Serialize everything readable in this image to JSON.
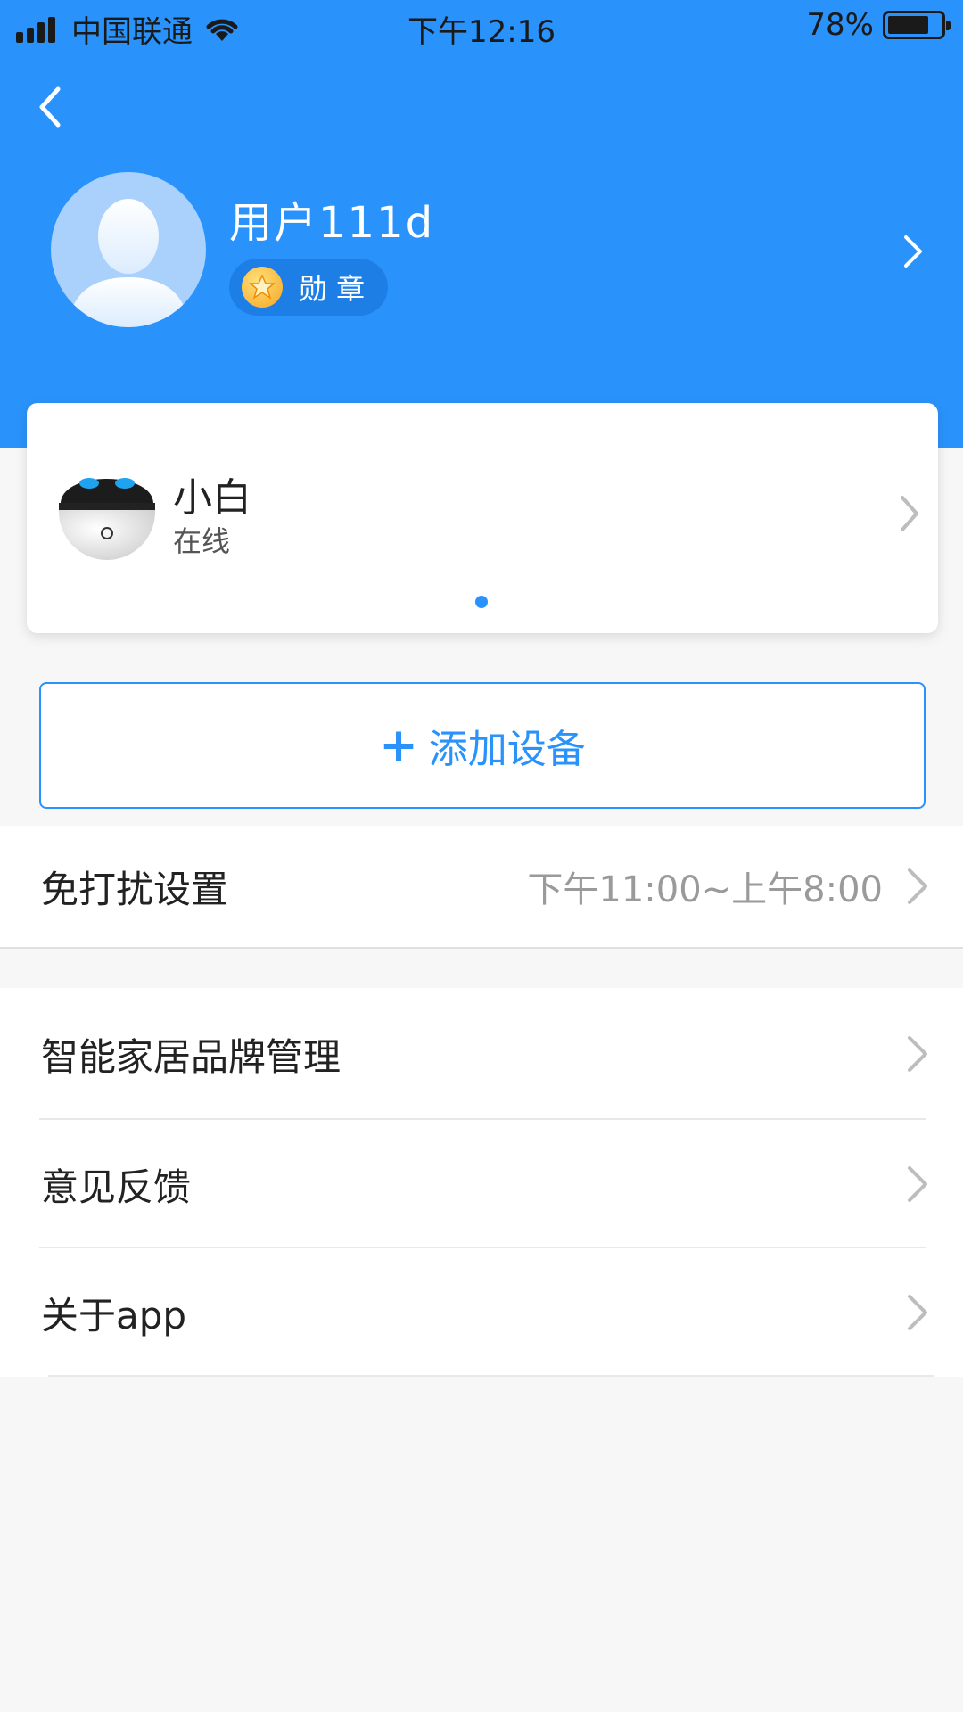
{
  "status_bar": {
    "carrier": "中国联通",
    "time": "下午12:16",
    "battery": "78%",
    "battery_level": 0.78
  },
  "header": {
    "back_icon": "chevron-left-icon",
    "username": "用户111d",
    "medal_label": "勋 章",
    "profile_arrow_icon": "chevron-right-icon"
  },
  "device": {
    "name": "小白",
    "status": "在线",
    "page_count": 1
  },
  "add_device": {
    "plus": "+",
    "label": "添加设备"
  },
  "dnd": {
    "label": "免打扰设置",
    "value": "下午11:00~上午8:00"
  },
  "menu": [
    {
      "label": "智能家居品牌管理"
    },
    {
      "label": "意见反馈"
    },
    {
      "label": "关于app"
    }
  ],
  "colors": {
    "primary": "#2a93fb",
    "background": "#f7f7f7"
  }
}
